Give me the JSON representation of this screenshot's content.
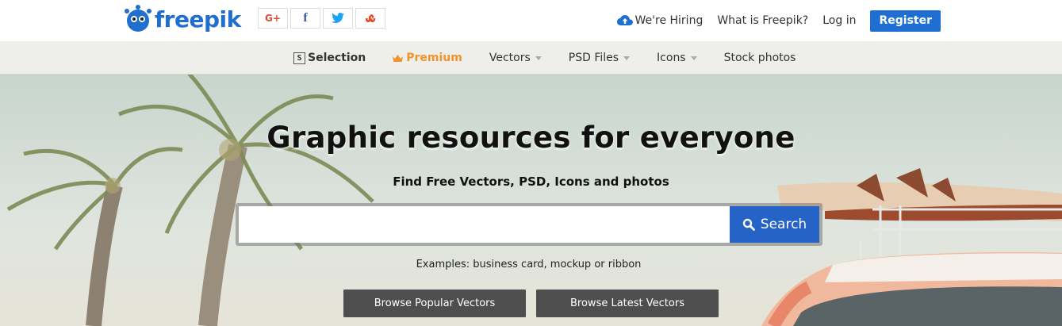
{
  "brand": {
    "name": "freepik",
    "color": "#1f6fd1"
  },
  "social": [
    {
      "icon": "google-plus-icon",
      "label": "G+",
      "color": "#dd4b39"
    },
    {
      "icon": "facebook-icon",
      "label": "f",
      "color": "#3b5998"
    },
    {
      "icon": "twitter-icon",
      "label": "",
      "color": "#1da1f2"
    },
    {
      "icon": "stumbleupon-icon",
      "label": "",
      "color": "#eb4924"
    }
  ],
  "header": {
    "hiring": "We're Hiring",
    "what_is": "What is Freepik?",
    "login": "Log in",
    "register": "Register"
  },
  "nav": {
    "selection": "Selection",
    "selection_badge": "S",
    "premium": "Premium",
    "premium_color": "#f0932b",
    "vectors": "Vectors",
    "psd": "PSD Files",
    "icons": "Icons",
    "stock": "Stock photos"
  },
  "hero": {
    "title": "Graphic resources for everyone",
    "subtitle": "Find Free Vectors, PSD, Icons and photos",
    "search_placeholder": "",
    "search_button": "Search",
    "examples": "Examples: business card, mockup or ribbon",
    "browse_popular": "Browse Popular Vectors",
    "browse_latest": "Browse Latest Vectors"
  }
}
